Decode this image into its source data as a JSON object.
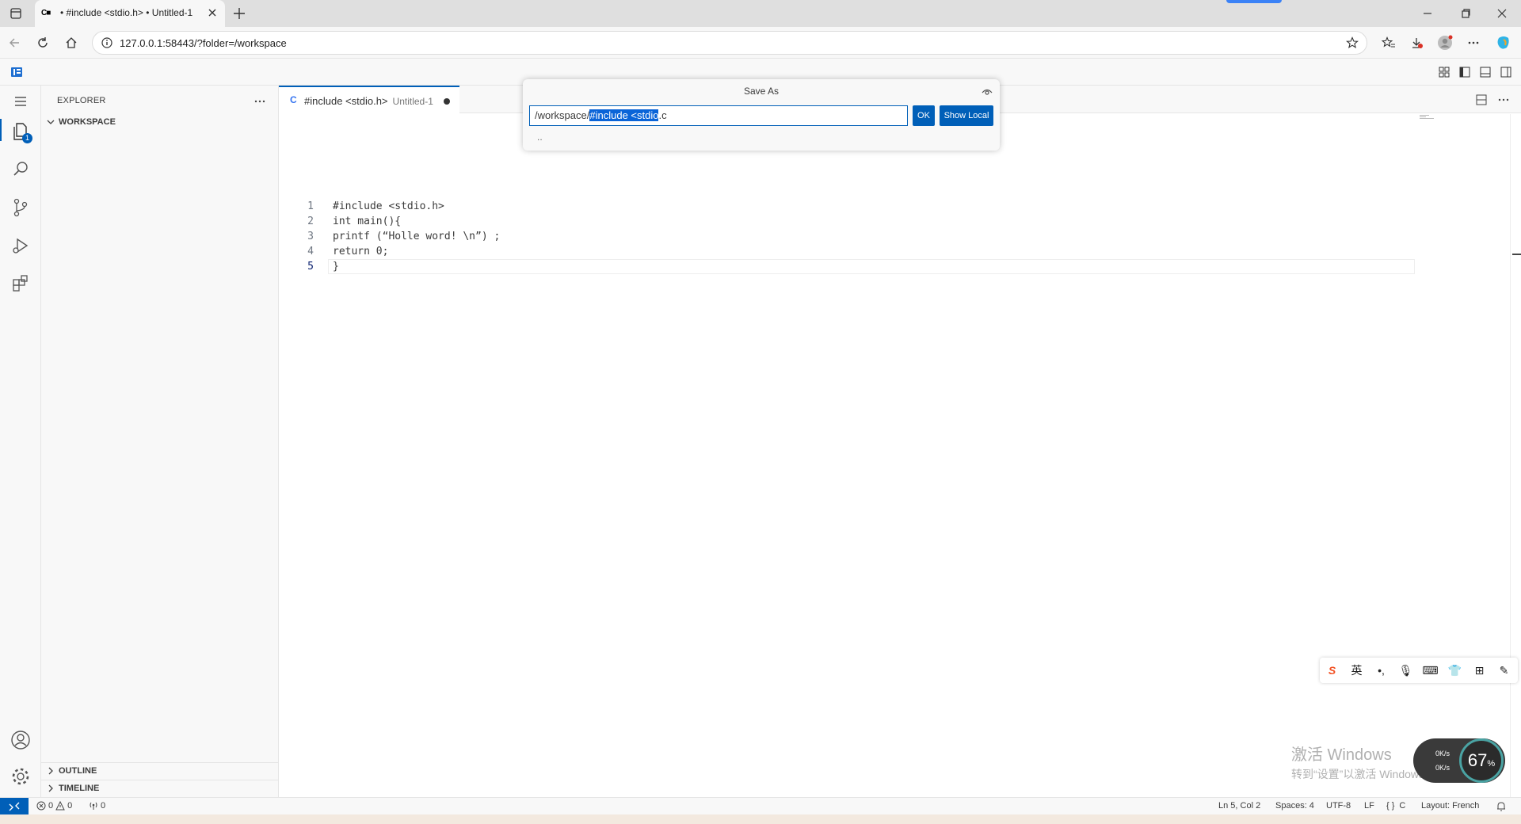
{
  "browser": {
    "tab_title": "• #include <stdio.h> • Untitled-1",
    "tab_favicon": "C■",
    "url": "127.0.0.1:58443/?folder=/workspace"
  },
  "sidebar": {
    "header": "EXPLORER",
    "workspace": "WORKSPACE",
    "outline": "OUTLINE",
    "timeline": "TIMELINE",
    "explorer_badge": "1"
  },
  "editor": {
    "tab_lang": "C",
    "tab_name": "#include <stdio.h>",
    "tab_desc": "Untitled-1",
    "lines": [
      {
        "n": "1",
        "text": "#include <stdio.h>"
      },
      {
        "n": "2",
        "text": "int main(){"
      },
      {
        "n": "3",
        "text": "printf (“Holle word! \\n”) ;"
      },
      {
        "n": "4",
        "text": "return 0;"
      },
      {
        "n": "5",
        "text": "}"
      }
    ]
  },
  "save_as": {
    "title": "Save As",
    "input_prefix": "/workspace/",
    "input_selected": "#include <stdio",
    "input_suffix": ".c",
    "ok_label": "OK",
    "show_local_label": "Show Local",
    "parent_item": ".."
  },
  "status": {
    "errors": "0",
    "warnings": "0",
    "ports": "0",
    "position": "Ln 5, Col 2",
    "spaces": "Spaces: 4",
    "encoding": "UTF-8",
    "eol": "LF",
    "language": "C",
    "layout": "Layout: French"
  },
  "ime": {
    "items": [
      "S",
      "英",
      "•,",
      "🎙",
      "⌨",
      "👕",
      "⊞",
      "✎"
    ]
  },
  "watermark": {
    "line1": "激活 Windows",
    "line2": "转到“设置”以激活 Windows。"
  },
  "net": {
    "up": "0K/s",
    "down": "0K/s",
    "percent": "67",
    "percent_unit": "%"
  },
  "colors": {
    "accent": "#005fb8",
    "selection": "#0a64d8"
  }
}
